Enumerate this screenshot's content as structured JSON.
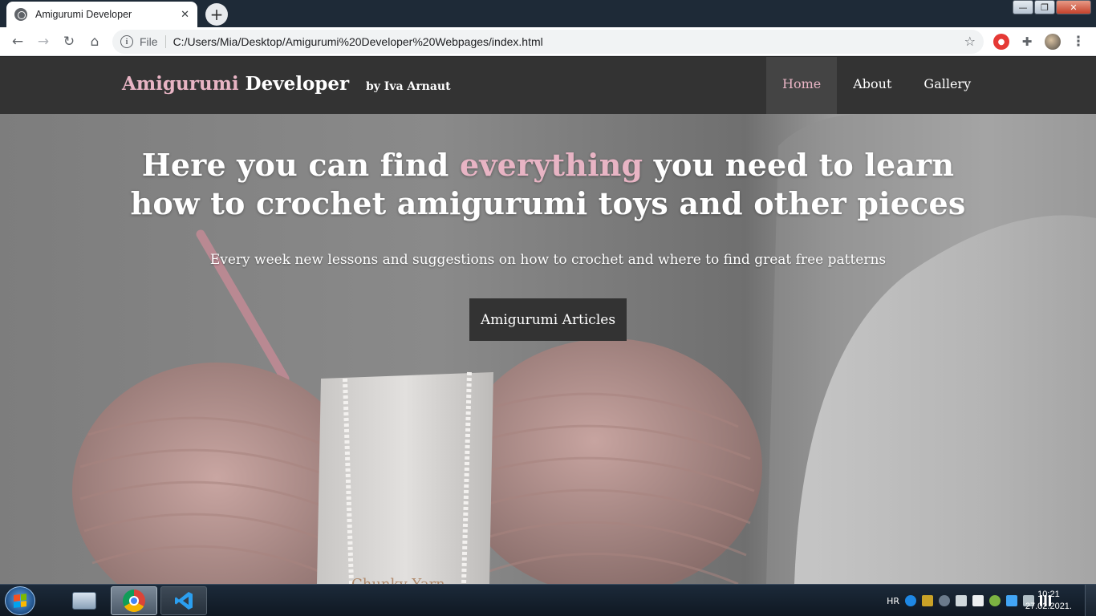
{
  "browser": {
    "tab_title": "Amigurumi Developer",
    "tab_close": "✕",
    "new_tab": "+",
    "url_scheme": "File",
    "url": "C:/Users/Mia/Desktop/Amigurumi%20Developer%20Webpages/index.html",
    "back_icon": "←",
    "forward_icon": "→",
    "reload_icon": "↻",
    "home_icon": "⌂",
    "bookmark_icon": "☆",
    "menu_icon": "⋮",
    "window_controls": {
      "minimize": "—",
      "maximize": "❐",
      "close": "✕"
    }
  },
  "site": {
    "brand_highlight": "Amigurumi",
    "brand_rest": " Developer",
    "byline": "by Iva Arnaut",
    "nav": [
      {
        "label": "Home",
        "active": true
      },
      {
        "label": "About",
        "active": false
      },
      {
        "label": "Gallery",
        "active": false
      }
    ],
    "hero": {
      "heading_before": "Here you can find ",
      "heading_highlight": "everything",
      "heading_after": " you need to learn how to crochet amigurumi toys and other pieces",
      "lead": "Every week new lessons and suggestions on how to crochet and where to find great free patterns",
      "cta": "Amigurumi Articles",
      "yarn_label": "Chunky Yarn"
    },
    "colors": {
      "accent_pink": "#e8b4c4",
      "header_bg": "#333333",
      "active_nav_bg": "#444444"
    }
  },
  "taskbar": {
    "language": "HR",
    "time": "10:21",
    "date": "27.02.2021."
  }
}
